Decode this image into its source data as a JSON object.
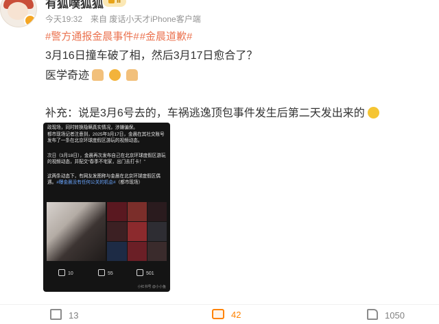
{
  "user": {
    "name": "有狐噗狐狐",
    "level": "Ⅱ"
  },
  "meta": {
    "time": "今天19:32",
    "source": "来自 废话小天才iPhone客户端"
  },
  "hashtags": [
    "#警方通报金晨事件#",
    "#金晨道歉#"
  ],
  "text": {
    "line1": "3月16日撞车破了相，然后3月17日愈合了？",
    "line2": "医学奇迹",
    "line3": "补充：说是3月6号去的，车祸逃逸顶包事件发生后第二天发出来的"
  },
  "embedded": {
    "p1": "政现场，同时转换隐瞒真实情况，涉嫌骗保。",
    "p2": "都市现场记者注意到，2025年3月17日，金晨在其社交账号发布了一条在北京环球度假区游玩的视频动态。",
    "p3": "次日（3月18日），金晨再次发布自己在北京环球度假区游玩的视频动态，并配文“春季不宅家，出门去打卡！”",
    "p4": "这两条动态下，有网友发图称与金晨在北京环球度假区偶遇。",
    "p4_link": "#曝金晨没有任何公关的机会#",
    "p4_tail": "（都市现场）",
    "share": "10",
    "comments": "55",
    "likes": "501",
    "watermark": "小红书号 @小小鱼"
  },
  "actions": {
    "share": "13",
    "comment": "42",
    "like": "1050"
  },
  "icons": {
    "share": "share-icon",
    "comment": "comment-icon",
    "like": "like-icon"
  },
  "colors": {
    "hashtag": "#eb7350",
    "comment_accent": "#ff8200",
    "meta": "#939393"
  }
}
